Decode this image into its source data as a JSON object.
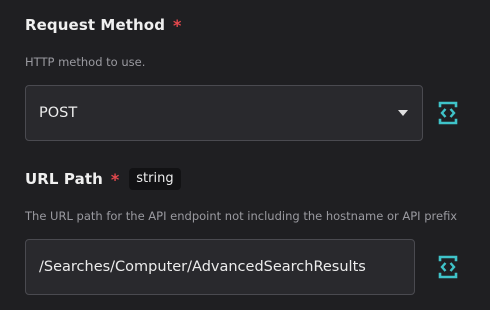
{
  "request_method": {
    "label": "Request Method",
    "required_mark": "*",
    "help": "HTTP method to use.",
    "value": "POST",
    "toggle_icon": "code-brackets-icon"
  },
  "url_path": {
    "label": "URL Path",
    "required_mark": "*",
    "type_badge": "string",
    "help": "The URL path for the API endpoint not including the hostname or API prefix",
    "value": "/Searches/Computer/AdvancedSearchResults",
    "toggle_icon": "code-brackets-icon"
  },
  "colors": {
    "background": "#1f1f22",
    "required": "#e5484d",
    "accent": "#3fc3c9",
    "input_bg": "#29292d",
    "input_border": "#4a4a50"
  }
}
